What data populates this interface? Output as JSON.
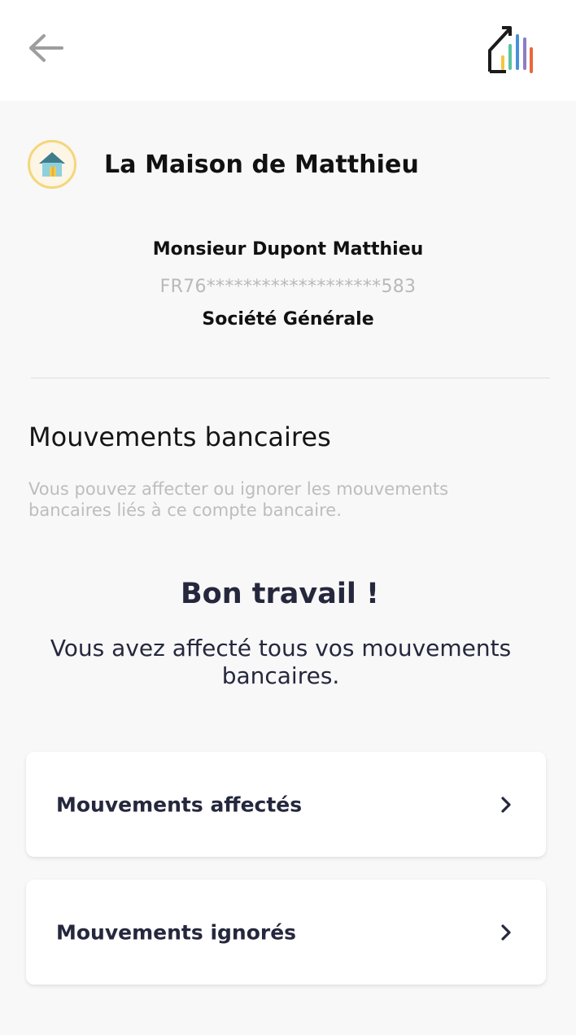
{
  "header": {
    "back_icon": "arrow-left-icon",
    "logo_icon": "house-bars-logo-icon"
  },
  "property": {
    "icon": "house-icon",
    "name": "La Maison de Matthieu"
  },
  "account": {
    "holder": "Monsieur Dupont Matthieu",
    "iban": "FR76*******************583",
    "bank": "Société Générale"
  },
  "movements": {
    "title": "Mouvements bancaires",
    "description": "Vous pouvez affecter ou ignorer les mouvements bancaires liés à ce compte bancaire."
  },
  "success": {
    "title": "Bon travail !",
    "message": "Vous avez affecté tous vos mouvements bancaires."
  },
  "links": [
    {
      "label": "Mouvements affectés",
      "icon": "chevron-right-icon"
    },
    {
      "label": "Mouvements ignorés",
      "icon": "chevron-right-icon"
    }
  ],
  "colors": {
    "background": "#f8f8f8",
    "header": "#ffffff",
    "text_dark": "#25283d",
    "muted": "#bdbdbd",
    "avatar_border": "#f5d67a",
    "logo_bars": [
      "#f5c542",
      "#59c3a1",
      "#4a90d9",
      "#e8673c"
    ]
  }
}
